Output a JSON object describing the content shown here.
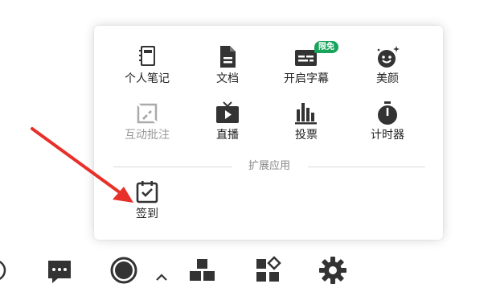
{
  "popup": {
    "tools": [
      {
        "label": "个人笔记",
        "icon": "notebook-icon",
        "enabled": true
      },
      {
        "label": "文档",
        "icon": "document-icon",
        "enabled": true
      },
      {
        "label": "开启字幕",
        "icon": "subtitle-icon",
        "enabled": true,
        "badge": "限免"
      },
      {
        "label": "美颜",
        "icon": "beauty-face-icon",
        "enabled": true
      },
      {
        "label": "互动批注",
        "icon": "annotation-icon",
        "enabled": false
      },
      {
        "label": "直播",
        "icon": "live-tv-icon",
        "enabled": true
      },
      {
        "label": "投票",
        "icon": "vote-chart-icon",
        "enabled": true
      },
      {
        "label": "计时器",
        "icon": "timer-icon",
        "enabled": true
      }
    ],
    "section_label": "扩展应用",
    "extensions": [
      {
        "label": "签到",
        "icon": "check-in-calendar-icon"
      }
    ]
  },
  "colors": {
    "icon": "#333333",
    "icon_disabled": "#aaaaaa",
    "badge": "#19a35b",
    "arrow": "#e8302a"
  },
  "toolbar": {
    "items": [
      "chat-bubble-icon",
      "record-circle-icon",
      "caret-up-icon",
      "apps-blocks-icon",
      "apps-grid-icon",
      "gear-icon"
    ]
  }
}
